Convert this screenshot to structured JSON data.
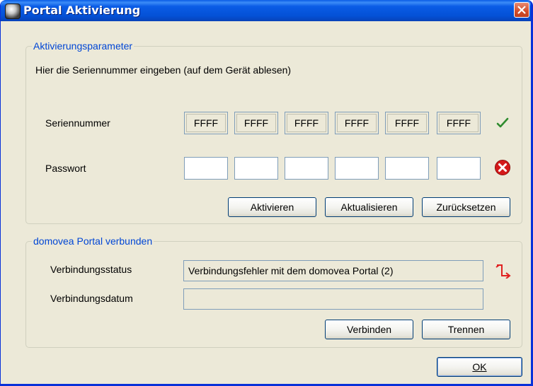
{
  "window": {
    "title": "Portal Aktivierung"
  },
  "activation": {
    "legend": "Aktivierungsparameter",
    "instruction": "Hier die Seriennummer eingeben (auf dem Gerät ablesen)",
    "serial_label": "Seriennummer",
    "serial_segments": [
      "FFFF",
      "FFFF",
      "FFFF",
      "FFFF",
      "FFFF",
      "FFFF"
    ],
    "password_label": "Passwort",
    "password_segments": [
      "",
      "",
      "",
      "",
      "",
      ""
    ],
    "serial_status_icon": "check-icon",
    "password_status_icon": "error-icon",
    "buttons": {
      "activate": "Aktivieren",
      "refresh": "Aktualisieren",
      "reset": "Zurücksetzen"
    }
  },
  "portal": {
    "legend": "domovea Portal verbunden",
    "status_label": "Verbindungsstatus",
    "status_value": "Verbindungsfehler mit dem domovea Portal (2)",
    "date_label": "Verbindungsdatum",
    "date_value": "",
    "status_icon": "disconnected-icon",
    "buttons": {
      "connect": "Verbinden",
      "disconnect": "Trennen"
    }
  },
  "footer": {
    "ok_label": "OK"
  },
  "colors": {
    "titlebar": "#0a5ce6",
    "legend": "#0046d5",
    "check": "#2e8b2e",
    "error": "#d41a1a"
  }
}
